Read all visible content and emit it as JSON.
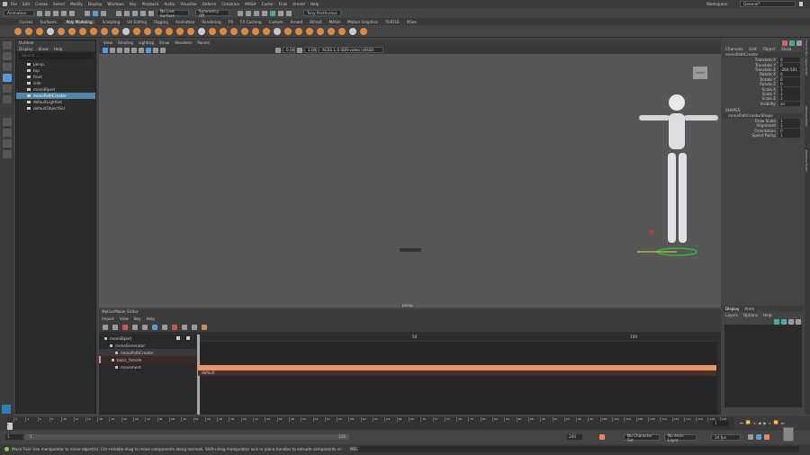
{
  "menubar": {
    "items": [
      "File",
      "Edit",
      "Create",
      "Select",
      "Modify",
      "Display",
      "Windows",
      "Key",
      "Playback",
      "Audio",
      "Visualize",
      "Deform",
      "Constrain",
      "MASH",
      "Cache",
      "Flow",
      "Arnold",
      "Help"
    ],
    "workspace_label": "Workspace:",
    "workspace_value": "General*"
  },
  "toolbar": {
    "mode": "Animation",
    "live_surface": "No Live Surface",
    "symmetry": "Symmetry: Off",
    "user": "Tony Posthumus"
  },
  "shelf": {
    "tabs": [
      "Curves",
      "Surfaces",
      "Poly Modeling",
      "Sculpting",
      "UV Editing",
      "Rigging",
      "Animation",
      "Rendering",
      "FX",
      "FX Caching",
      "Custom",
      "Arnold",
      "Bifrost",
      "MASH",
      "Motion Graphics",
      "TURTLE",
      "XGen"
    ],
    "active": "Poly Modeling"
  },
  "outliner": {
    "title": "Outliner",
    "menu": [
      "Display",
      "Show",
      "Help"
    ],
    "search_placeholder": "Search...",
    "items": [
      {
        "label": "persp",
        "selected": false
      },
      {
        "label": "top",
        "selected": false
      },
      {
        "label": "front",
        "selected": false
      },
      {
        "label": "side",
        "selected": false
      },
      {
        "label": "monoBiped",
        "selected": false
      },
      {
        "label": "monoPathCreator",
        "selected": true
      },
      {
        "label": "defaultLightSet",
        "selected": false
      },
      {
        "label": "defaultObjectSet",
        "selected": false
      }
    ]
  },
  "viewport": {
    "menu": [
      "View",
      "Shading",
      "Lighting",
      "Show",
      "Renderer",
      "Panels"
    ],
    "exposure": "0.00",
    "gamma": "1.00",
    "color_space": "ACES 1.0 SDR-video (sRGB)",
    "camera_label": "persp",
    "viewcube_label": "FRONT"
  },
  "channel_box": {
    "menu": [
      "Channels",
      "Edit",
      "Object",
      "Show"
    ],
    "object": "monoPathCreator",
    "channels": [
      {
        "name": "Translate X",
        "value": "0"
      },
      {
        "name": "Translate Y",
        "value": "0"
      },
      {
        "name": "Translate Z",
        "value": "-284.581"
      },
      {
        "name": "Rotate X",
        "value": "0"
      },
      {
        "name": "Rotate Y",
        "value": "0"
      },
      {
        "name": "Rotate Z",
        "value": "0"
      },
      {
        "name": "Scale X",
        "value": "1"
      },
      {
        "name": "Scale Y",
        "value": "1"
      },
      {
        "name": "Scale Z",
        "value": "1"
      },
      {
        "name": "Visibility",
        "value": "on"
      }
    ],
    "shapes_label": "SHAPES",
    "shape_name": "monoPathCreatorShape",
    "shape_channels": [
      {
        "name": "Draw Scale",
        "value": "1"
      },
      {
        "name": "Alignment",
        "value": "1"
      },
      {
        "name": "Orientation",
        "value": "0"
      },
      {
        "name": "Speed Ramp",
        "value": "1"
      }
    ],
    "side_tabs": [
      "Channel Box / Layer Editor",
      "Attribute Editor",
      "Modeling Toolkit"
    ]
  },
  "layers": {
    "tabs": [
      "Display",
      "Anim"
    ],
    "menu": [
      "Layers",
      "Options",
      "Help"
    ]
  },
  "motionmaker": {
    "title": "MotionMaker Editor",
    "menu": [
      "Import",
      "View",
      "Key",
      "Help"
    ],
    "tree": [
      "monoBiped",
      "monoGenerator",
      "monoPathCreator",
      "basic_female",
      "movement"
    ],
    "ruler": [
      "50",
      "100"
    ],
    "clip_label": "default",
    "clip_color": "#e8956a"
  },
  "timeline": {
    "ticks": [
      "2",
      "4",
      "6",
      "8",
      "10",
      "12",
      "14",
      "16",
      "18",
      "20",
      "22",
      "24",
      "26",
      "28",
      "30",
      "32",
      "34",
      "36",
      "38",
      "40",
      "42",
      "44",
      "46",
      "48",
      "50",
      "52",
      "54",
      "56",
      "58",
      "60",
      "62",
      "64",
      "66",
      "68",
      "70",
      "72",
      "74",
      "76",
      "78",
      "80",
      "82",
      "84",
      "86",
      "88",
      "90",
      "92",
      "94",
      "96",
      "98",
      "100",
      "102",
      "104",
      "106",
      "108",
      "110",
      "112",
      "114",
      "116",
      "118",
      "120"
    ],
    "current_frame": "1",
    "start_marker": "1"
  },
  "range": {
    "start": "1",
    "inner_start": "1",
    "inner_end": "120",
    "end": "200",
    "character_set": "No Character Set",
    "anim_layer": "No Anim Layer",
    "fps": "24 fps"
  },
  "help": {
    "text": "Move Tool: Use manipulator to move object(s). Ctrl+middle-drag to move components along normals. Shift+drag manipulator axis or plane handles to extrude components or clone objects. Ctrl+Shift+drag to constrain movement to a con",
    "mel_label": "MEL"
  }
}
